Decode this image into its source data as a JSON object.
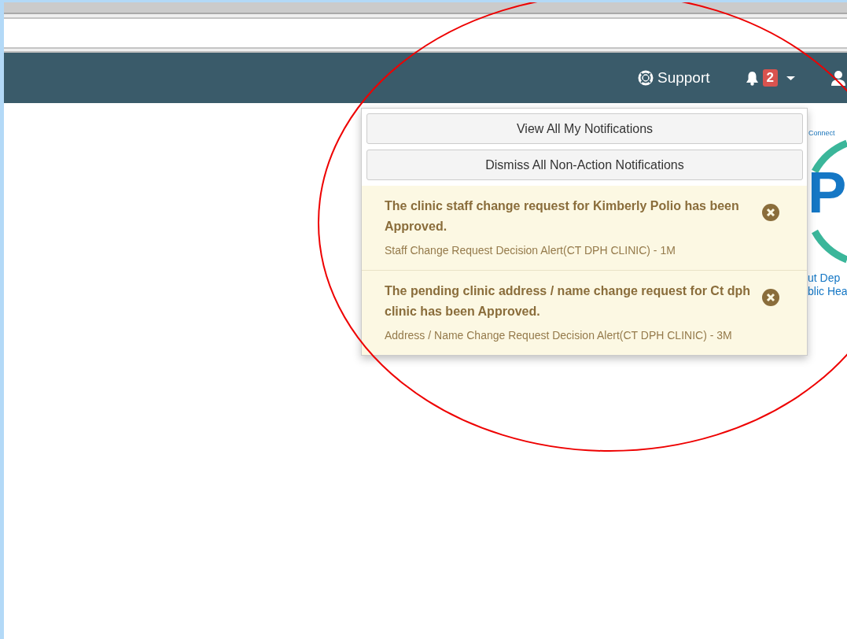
{
  "navbar": {
    "support_label": "Support",
    "notification_count": "2"
  },
  "notifications_menu": {
    "buttons": [
      "View All My Notifications",
      "Dismiss All Non-Action Notifications"
    ],
    "items": [
      {
        "message": "The clinic staff change request for Kimberly Polio has been Approved.",
        "detail": "Staff Change Request Decision Alert(CT DPH CLINIC) - 1M"
      },
      {
        "message": "The pending clinic address / name change request for Ct dph clinic has been Approved.",
        "detail": "Address / Name Change Request Decision Alert(CT DPH CLINIC) - 3M"
      }
    ]
  },
  "logo": {
    "arc_text": "Connect",
    "letters": "P",
    "lines": [
      "ut Dep",
      "blic Hea"
    ]
  }
}
